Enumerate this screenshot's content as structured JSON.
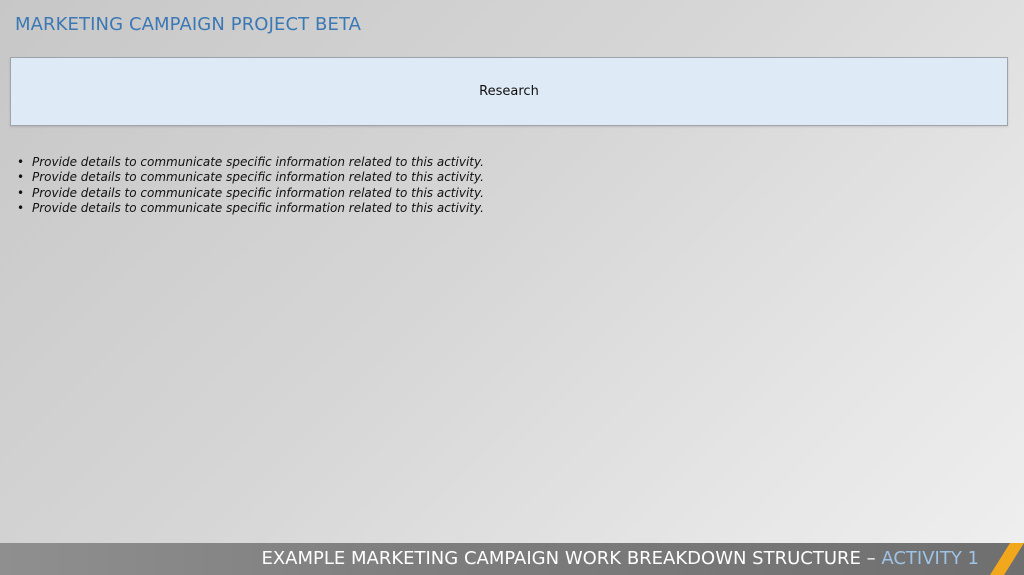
{
  "header": {
    "title": "MARKETING CAMPAIGN PROJECT BETA"
  },
  "activity": {
    "label": "Research"
  },
  "details": {
    "items": [
      "Provide details to communicate specific information related to this activity.",
      "Provide details to communicate specific information related to this activity.",
      "Provide details to communicate specific information related to this activity.",
      "Provide details to communicate specific information related to this activity."
    ]
  },
  "footer": {
    "title_main": "EXAMPLE MARKETING CAMPAIGN WORK BREAKDOWN STRUCTURE – ",
    "title_accent": "ACTIVITY 1"
  },
  "colors": {
    "title": "#3b78b4",
    "box_fill": "#deeaf6",
    "footer_accent": "#9dc3e6",
    "stripe": "#f2a81d"
  }
}
